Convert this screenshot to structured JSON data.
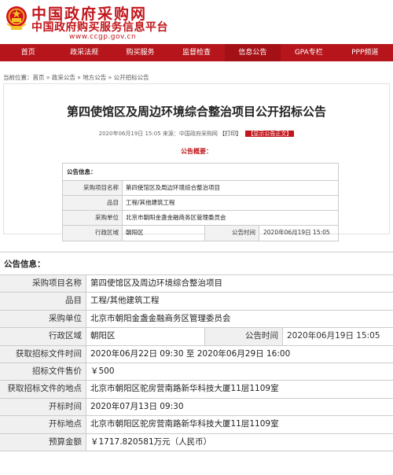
{
  "header": {
    "title": "中国政府采购网",
    "subtitle": "中国政府购买服务信息平台",
    "url": "www.ccgp.gov.cn",
    "icon": "national-emblem"
  },
  "nav": {
    "items": [
      "首页",
      "政采法规",
      "购买服务",
      "监督检查",
      "信息公告",
      "GPA专栏",
      "PPP频道"
    ],
    "active_index": 4
  },
  "breadcrumb": {
    "prefix": "当前位置：",
    "items": [
      "首页",
      "政采公告",
      "地方公告",
      "公开招标公告"
    ],
    "separator": " » "
  },
  "article": {
    "title": "第四使馆区及周边环境综合整治项目公开招标公告",
    "meta": "2020年06月19日 15:05 来源：中国政府采购网",
    "print": "【打印】",
    "tag": "【显示公告正文】",
    "summary_label": "公告概要："
  },
  "info_table": {
    "header": "公告信息：",
    "rows": [
      {
        "label": "采购项目名称",
        "value": "第四使馆区及周边环境综合整治项目"
      },
      {
        "label": "品目",
        "value": "工程/其他建筑工程"
      },
      {
        "label": "采购单位",
        "value": "北京市朝阳金盏金融商务区管理委员会"
      },
      {
        "label": "行政区域",
        "value": "朝阳区",
        "label2": "公告时间",
        "value2": "2020年06月19日 15:05"
      }
    ]
  },
  "big_table": {
    "header": "公告信息：",
    "rows": [
      {
        "label": "采购项目名称",
        "value": "第四使馆区及周边环境综合整治项目"
      },
      {
        "label": "品目",
        "value": "工程/其他建筑工程"
      },
      {
        "label": "采购单位",
        "value": "北京市朝阳金盏金融商务区管理委员会"
      },
      {
        "label": "行政区域",
        "value": "朝阳区",
        "label2": "公告时间",
        "value2": "2020年06月19日 15:05"
      },
      {
        "label": "获取招标文件时间",
        "value": "2020年06月22日 09:30  至  2020年06月29日 16:00"
      },
      {
        "label": "招标文件售价",
        "value": "￥500"
      },
      {
        "label": "获取招标文件的地点",
        "value": "北京市朝阳区驼房营南路新华科技大厦11层1109室"
      },
      {
        "label": "开标时间",
        "value": "2020年07月13日 09:30"
      },
      {
        "label": "开标地点",
        "value": "北京市朝阳区驼房营南路新华科技大厦11层1109室"
      },
      {
        "label": "预算金额",
        "value": "￥1717.820581万元（人民币）"
      }
    ]
  },
  "colors": {
    "brand_red": "#c2161b",
    "nav_bg": "#b5151b"
  }
}
